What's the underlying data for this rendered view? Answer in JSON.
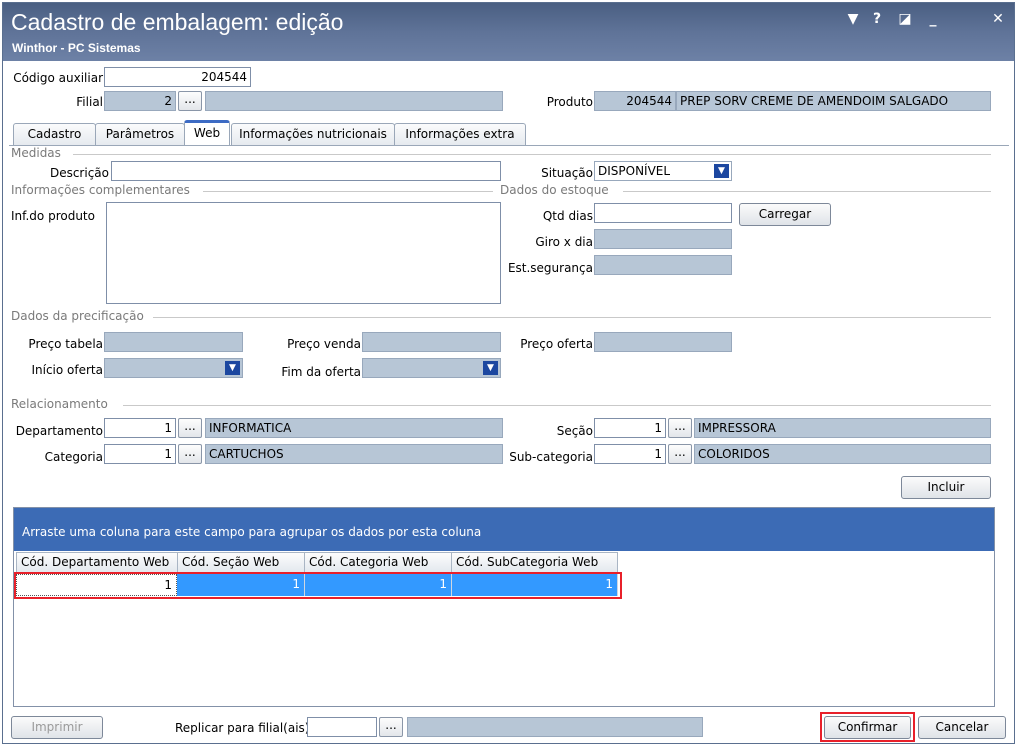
{
  "window": {
    "title": "Cadastro de embalagem: edição",
    "subtitle": "Winthor - PC Sistemas",
    "controls": [
      "▼",
      "?",
      "◪",
      "_",
      "✕"
    ]
  },
  "header": {
    "codigo_auxiliar_label": "Código auxiliar",
    "codigo_auxiliar_value": "204544",
    "filial_label": "Filial",
    "filial_value": "2",
    "filial_desc": "",
    "produto_label": "Produto",
    "produto_value": "204544",
    "produto_desc": "PREP SORV CREME DE AMENDOIM SALGADO"
  },
  "tabs": [
    {
      "label": "Cadastro",
      "active": false
    },
    {
      "label": "Parâmetros",
      "active": false
    },
    {
      "label": "Web",
      "active": true
    },
    {
      "label": "Informações nutricionais",
      "active": false
    },
    {
      "label": "Informações extra",
      "active": false
    }
  ],
  "medidas": {
    "section_label": "Medidas",
    "descricao_label": "Descrição",
    "descricao_value": "",
    "situacao_label": "Situação",
    "situacao_value": "DISPONÍVEL"
  },
  "info_compl": {
    "section_label": "Informações complementares",
    "inf_produto_label": "Inf.do produto",
    "inf_produto_value": ""
  },
  "estoque": {
    "section_label": "Dados do estoque",
    "qtd_dias_label": "Qtd dias",
    "qtd_dias_value": "",
    "carregar_label": "Carregar",
    "giro_label": "Giro x dia",
    "est_seg_label": "Est.segurança"
  },
  "precificacao": {
    "section_label": "Dados da precificação",
    "preco_tabela_label": "Preço tabela",
    "preco_venda_label": "Preço venda",
    "preco_oferta_label": "Preço oferta",
    "inicio_oferta_label": "Início oferta",
    "fim_oferta_label": "Fim da oferta"
  },
  "relacionamento": {
    "section_label": "Relacionamento",
    "departamento_label": "Departamento",
    "departamento_code": "1",
    "departamento_desc": "INFORMATICA",
    "secao_label": "Seção",
    "secao_code": "1",
    "secao_desc": "IMPRESSORA",
    "categoria_label": "Categoria",
    "categoria_code": "1",
    "categoria_desc": "CARTUCHOS",
    "subcategoria_label": "Sub-categoria",
    "subcategoria_code": "1",
    "subcategoria_desc": "COLORIDOS",
    "incluir_label": "Incluir",
    "dots": "..."
  },
  "grid": {
    "group_hint": "Arraste uma coluna para este campo para agrupar os dados por esta coluna",
    "columns": [
      "Cód. Departamento Web",
      "Cód. Seção Web",
      "Cód. Categoria Web",
      "Cód. SubCategoria Web"
    ],
    "rows": [
      [
        "1",
        "1",
        "1",
        "1"
      ]
    ]
  },
  "footer": {
    "imprimir_label": "Imprimir",
    "replicar_label": "Replicar para filial(ais)",
    "replicar_value": "",
    "confirmar_label": "Confirmar",
    "cancelar_label": "Cancelar"
  },
  "colors": {
    "titlebar": "#5f7398",
    "grid_header": "#3c6bb5",
    "selection": "#3399ff",
    "highlight": "#e8202a"
  }
}
